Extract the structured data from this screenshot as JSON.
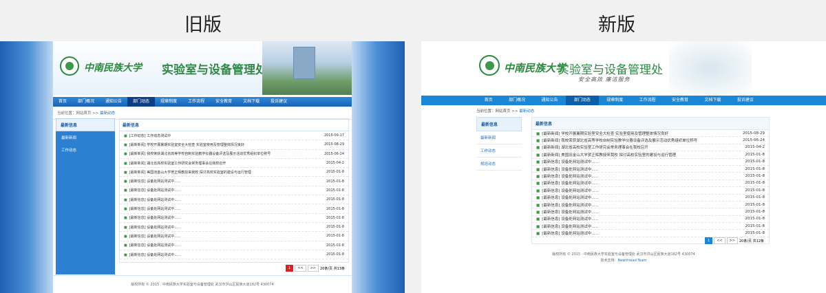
{
  "labels": {
    "old": "旧版",
    "new": "新版"
  },
  "brand": {
    "calligraphy": "中南民族大学",
    "dept": "实验室与设备管理处",
    "slogan": "安全高效 廉洁服务"
  },
  "nav": [
    "首页",
    "部门概况",
    "通知公告",
    "部门动态",
    "规章制度",
    "工作流程",
    "安全教育",
    "文档下载",
    "投诉建议"
  ],
  "crumb": {
    "prefix": "当前位置：网站首页 >> ",
    "current": "最新动态"
  },
  "old": {
    "side_title": "最新信息",
    "side_items": [
      "最新新闻",
      "工作动态"
    ],
    "main_title": "最新信息",
    "rows": [
      {
        "t": "[工作动态] 工作动态测试中",
        "d": "2015-09-17"
      },
      {
        "t": "[最新新闻] 学校开展暑期实验室安全大检查 实验室使用及管理整体情况良好",
        "d": "2015-08-29"
      },
      {
        "t": "[最新新闻] 我校荣获湖北省高等学校自制实验教学仪器设备评选及展示活动优秀组织单位称号",
        "d": "2015-06-24"
      },
      {
        "t": "[最新新闻] 湖北省高校实验室工作研究会常务理事会在我校召开",
        "d": "2015-04-2"
      },
      {
        "t": "[最新新闻] 美国旧金山大学贺正辉教授来我校 探讨高校实验室的建设与运行管理",
        "d": "2015-01-8"
      },
      {
        "t": "[最新信息] 设备处网站测试中......",
        "d": "2015-01-8"
      },
      {
        "t": "[最新信息] 设备处网站测试中......",
        "d": "2015-01-8"
      },
      {
        "t": "[最新信息] 设备处网站测试中......",
        "d": "2015-01-8"
      },
      {
        "t": "[最新信息] 设备处网站测试中......",
        "d": "2015-01-8"
      },
      {
        "t": "[最新信息] 设备处网站测试中......",
        "d": "2015-01-8"
      },
      {
        "t": "[最新信息] 设备处网站测试中......",
        "d": "2015-01-8"
      },
      {
        "t": "[最新信息] 设备处网站测试中......",
        "d": "2015-01-8"
      },
      {
        "t": "[最新信息] 设备处网站测试中......",
        "d": "2015-01-8"
      },
      {
        "t": "[最新信息] 设备处网站测试中......",
        "d": "2015-01-8"
      }
    ],
    "footer": "版权所有 © 2015 · 中南民族大学实验室与设备管理处 武汉市洪山区民族大道182号 430074"
  },
  "new": {
    "side_title": "最新信息",
    "side_items": [
      "最新新闻",
      "工作动态",
      "规培动态"
    ],
    "main_title": "最新信息",
    "rows": [
      {
        "t": "[最新新闻] 学校开展暑期实验室安全大检查 实验室使用及管理整体情况良好",
        "d": "2015-08-29"
      },
      {
        "t": "[最新新闻] 我校荣获湖北省高等学校自制实验教学仪器设备评选及展示活动优秀组织单位称号",
        "d": "2015-06-24"
      },
      {
        "t": "[最新新闻] 湖北省高校实验室工作研究会常务理事会在我校召开",
        "d": "2015-04-2"
      },
      {
        "t": "[最新新闻] 美国旧金山大学贺正辉教授来我校 探讨高校实验室的建设与运行管理",
        "d": "2015-01-8"
      },
      {
        "t": "[最新信息] 设备处网站测试中......",
        "d": "2015-01-8"
      },
      {
        "t": "[最新信息] 设备处网站测试中......",
        "d": "2015-01-8"
      },
      {
        "t": "[最新信息] 设备处网站测试中......",
        "d": "2015-01-8"
      },
      {
        "t": "[最新信息] 设备处网站测试中......",
        "d": "2015-01-8"
      },
      {
        "t": "[最新信息] 设备处网站测试中......",
        "d": "2015-01-8"
      },
      {
        "t": "[最新信息] 设备处网站测试中......",
        "d": "2015-01-8"
      },
      {
        "t": "[最新信息] 设备处网站测试中......",
        "d": "2015-01-8"
      },
      {
        "t": "[最新信息] 设备处网站测试中......",
        "d": "2015-01-8"
      },
      {
        "t": "[最新信息] 设备处网站测试中......",
        "d": "2015-01-8"
      },
      {
        "t": "[最新信息] 设备处网站测试中......",
        "d": "2015-01-8"
      },
      {
        "t": "[最新信息] 设备处网站测试中......",
        "d": "2015-01-8"
      }
    ],
    "footer": "版权所有 © 2015 · 中南民族大学实验室与设备管理处 武汉市洪山区民族大道182号 430074",
    "support_prefix": "技术支持：",
    "support_team": "Newthread Team"
  },
  "pager": {
    "current": "1",
    "prev": "<<",
    "next": ">>",
    "info_old": "20条/页 共13条",
    "info_new": "20条/页 共12条"
  }
}
